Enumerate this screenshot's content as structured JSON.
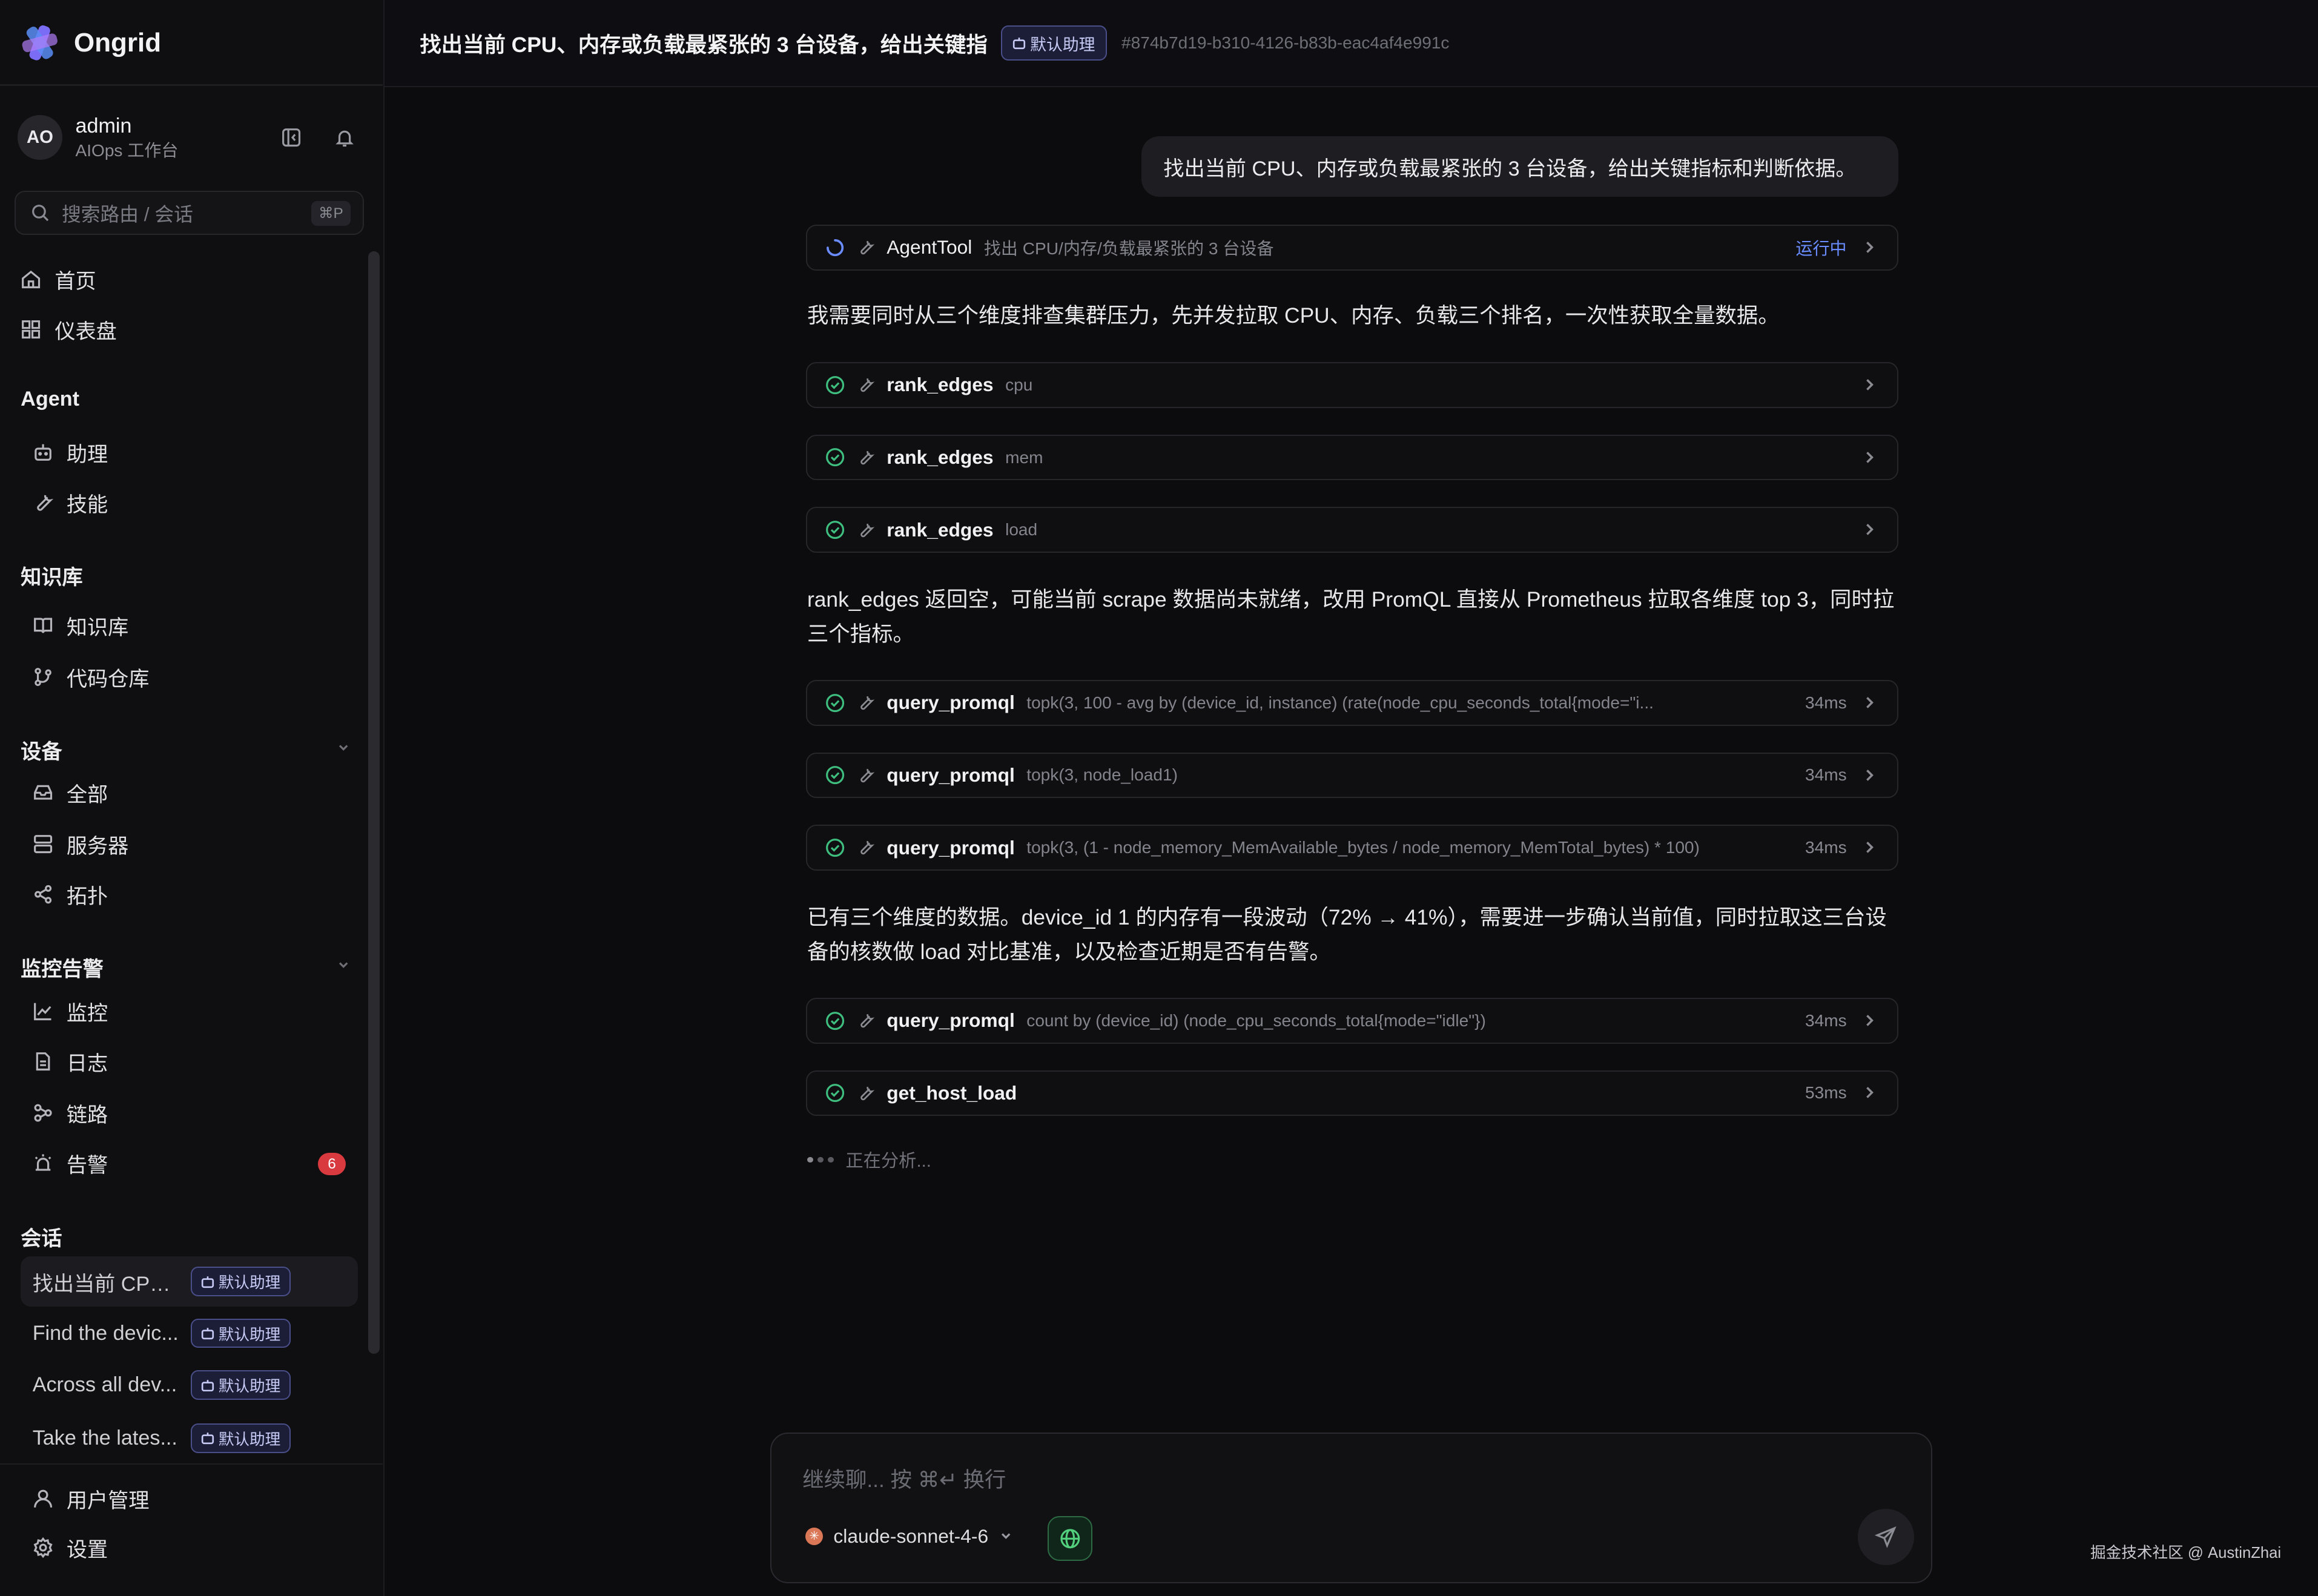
{
  "app": {
    "name": "Ongrid"
  },
  "user": {
    "initials": "AO",
    "name": "admin",
    "subtitle": "AIOps 工作台"
  },
  "search": {
    "placeholder": "搜索路由 / 会话",
    "shortcut": "⌘P"
  },
  "nav": {
    "top": [
      {
        "label": "首页",
        "icon": "home-icon"
      },
      {
        "label": "仪表盘",
        "icon": "dashboard-icon"
      }
    ],
    "sections": {
      "agent": {
        "title": "Agent",
        "items": [
          {
            "label": "助理",
            "icon": "bot-icon"
          },
          {
            "label": "技能",
            "icon": "wrench-icon"
          }
        ]
      },
      "knowledge": {
        "title": "知识库",
        "items": [
          {
            "label": "知识库",
            "icon": "book-icon"
          },
          {
            "label": "代码仓库",
            "icon": "git-branch-icon"
          }
        ]
      },
      "devices": {
        "title": "设备",
        "items": [
          {
            "label": "全部",
            "icon": "inbox-icon"
          },
          {
            "label": "服务器",
            "icon": "server-icon"
          },
          {
            "label": "拓扑",
            "icon": "share-icon"
          }
        ]
      },
      "monitoring": {
        "title": "监控告警",
        "items": [
          {
            "label": "监控",
            "icon": "chart-line-icon"
          },
          {
            "label": "日志",
            "icon": "file-text-icon"
          },
          {
            "label": "链路",
            "icon": "workflow-icon"
          },
          {
            "label": "告警",
            "icon": "siren-icon",
            "badge": "6"
          }
        ]
      },
      "conversations": {
        "title": "会话"
      }
    },
    "bottom": [
      {
        "label": "用户管理",
        "icon": "users-icon"
      },
      {
        "label": "设置",
        "icon": "gear-icon"
      }
    ]
  },
  "conversations": [
    {
      "title": "找出当前 CPU...",
      "agent": "默认助理",
      "active": true
    },
    {
      "title": "Find the devic...",
      "agent": "默认助理"
    },
    {
      "title": "Across all dev...",
      "agent": "默认助理"
    },
    {
      "title": "Take the lates...",
      "agent": "默认助理"
    }
  ],
  "header": {
    "title": "找出当前 CPU、内存或负载最紧张的 3 台设备，给出关键指",
    "agent": "默认助理",
    "session_id": "#874b7d19-b310-4126-b83b-eac4af4e991c"
  },
  "chat": {
    "user_message": "找出当前 CPU、内存或负载最紧张的 3 台设备，给出关键指标和判断依据。",
    "agent_tool": {
      "name": "AgentTool",
      "args": "找出 CPU/内存/负载最紧张的 3 台设备",
      "status": "运行中"
    },
    "msg1": "我需要同时从三个维度排查集群压力，先并发拉取 CPU、内存、负载三个排名，一次性获取全量数据。",
    "rank_tools": [
      {
        "name": "rank_edges",
        "args": "cpu"
      },
      {
        "name": "rank_edges",
        "args": "mem"
      },
      {
        "name": "rank_edges",
        "args": "load"
      }
    ],
    "msg2": "rank_edges 返回空，可能当前 scrape 数据尚未就绪，改用 PromQL 直接从 Prometheus 拉取各维度 top 3，同时拉三个指标。",
    "promql_tools": [
      {
        "name": "query_promql",
        "args": "topk(3, 100 - avg by (device_id, instance) (rate(node_cpu_seconds_total{mode=\"i...",
        "duration": "34ms"
      },
      {
        "name": "query_promql",
        "args": "topk(3, node_load1)",
        "duration": "34ms"
      },
      {
        "name": "query_promql",
        "args": "topk(3, (1 - node_memory_MemAvailable_bytes / node_memory_MemTotal_bytes) * 100)",
        "duration": "34ms"
      }
    ],
    "msg3": "已有三个维度的数据。device_id 1 的内存有一段波动（72% → 41%），需要进一步确认当前值，同时拉取这三台设备的核数做 load 对比基准，以及检查近期是否有告警。",
    "final_tools": [
      {
        "name": "query_promql",
        "args": "count by (device_id) (node_cpu_seconds_total{mode=\"idle\"})",
        "duration": "34ms"
      },
      {
        "name": "get_host_load",
        "args": "",
        "duration": "53ms"
      }
    ],
    "analyzing": "正在分析..."
  },
  "composer": {
    "placeholder": "继续聊... 按 ⌘↵ 换行",
    "model": "claude-sonnet-4-6"
  },
  "watermark": "掘金技术社区 @ AustinZhai",
  "colors": {
    "accent": "#6a8cff",
    "success": "#3fbf7f",
    "badge": "#d93a3f",
    "chip_bg": "#1c1e38"
  }
}
